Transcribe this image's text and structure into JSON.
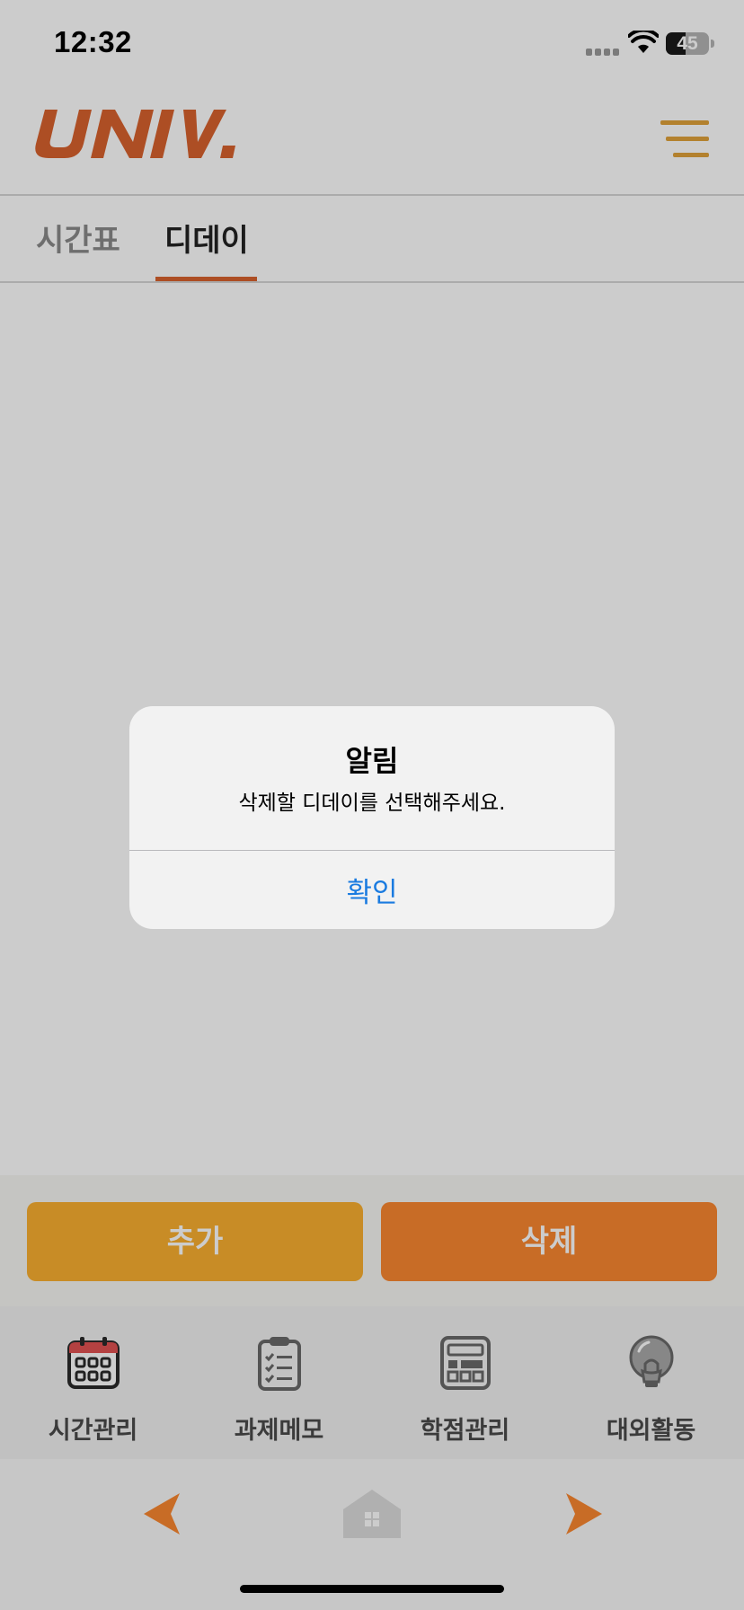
{
  "status_bar": {
    "time": "12:32",
    "battery": "45"
  },
  "header": {
    "logo_text": "UNIV."
  },
  "tabs": [
    {
      "label": "시간표",
      "active": false
    },
    {
      "label": "디데이",
      "active": true
    }
  ],
  "actions": {
    "add_label": "추가",
    "delete_label": "삭제"
  },
  "bottom_nav": [
    {
      "label": "시간관리",
      "icon": "calendar-icon"
    },
    {
      "label": "과제메모",
      "icon": "clipboard-icon"
    },
    {
      "label": "학점관리",
      "icon": "calculator-icon"
    },
    {
      "label": "대외활동",
      "icon": "lightbulb-icon"
    }
  ],
  "browser_nav": {
    "back_icon": "back-arrow-icon",
    "home_icon": "home-icon",
    "forward_icon": "forward-arrow-icon"
  },
  "alert": {
    "title": "알림",
    "message": "삭제할 디데이를 선택해주세요.",
    "confirm_label": "확인"
  },
  "colors": {
    "brand": "#d9622e",
    "add_button": "#fbb030",
    "delete_button": "#fb8830",
    "alert_action": "#1a7be0"
  }
}
